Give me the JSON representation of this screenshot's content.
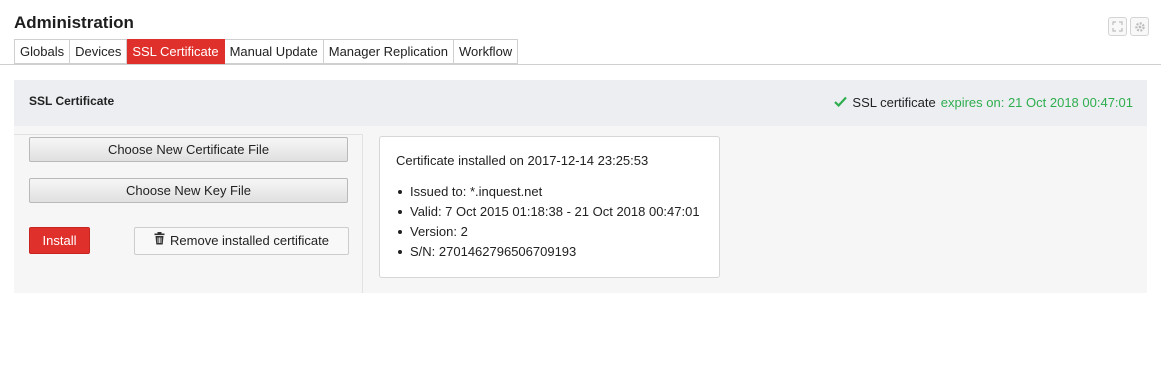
{
  "page_title": "Administration",
  "top_icons": [
    "expand-icon",
    "gear-icon"
  ],
  "tabs": [
    {
      "label": "Globals",
      "active": false
    },
    {
      "label": "Devices",
      "active": false
    },
    {
      "label": "SSL Certificate",
      "active": true
    },
    {
      "label": "Manual Update",
      "active": false
    },
    {
      "label": "Manager Replication",
      "active": false
    },
    {
      "label": "Workflow",
      "active": false
    }
  ],
  "panel": {
    "title": "SSL Certificate",
    "status": {
      "icon": "check-icon",
      "label": "SSL certificate",
      "expires": "expires on: 21 Oct 2018 00:47:01",
      "color": "#2fae4e"
    }
  },
  "actions": {
    "choose_cert": "Choose New Certificate File",
    "choose_key": "Choose New Key File",
    "install": "Install",
    "remove_icon": "trash-icon",
    "remove": "Remove installed certificate"
  },
  "certificate": {
    "installed": "Certificate installed on 2017-12-14 23:25:53",
    "details": [
      "Issued to: *.inquest.net",
      "Valid: 7 Oct 2015 01:18:38 - 21 Oct 2018 00:47:01",
      "Version: 2",
      "S/N: 2701462796506709193"
    ]
  },
  "colors": {
    "accent": "#e0302b",
    "success": "#2fae4e",
    "panel_header": "#eceef2"
  }
}
